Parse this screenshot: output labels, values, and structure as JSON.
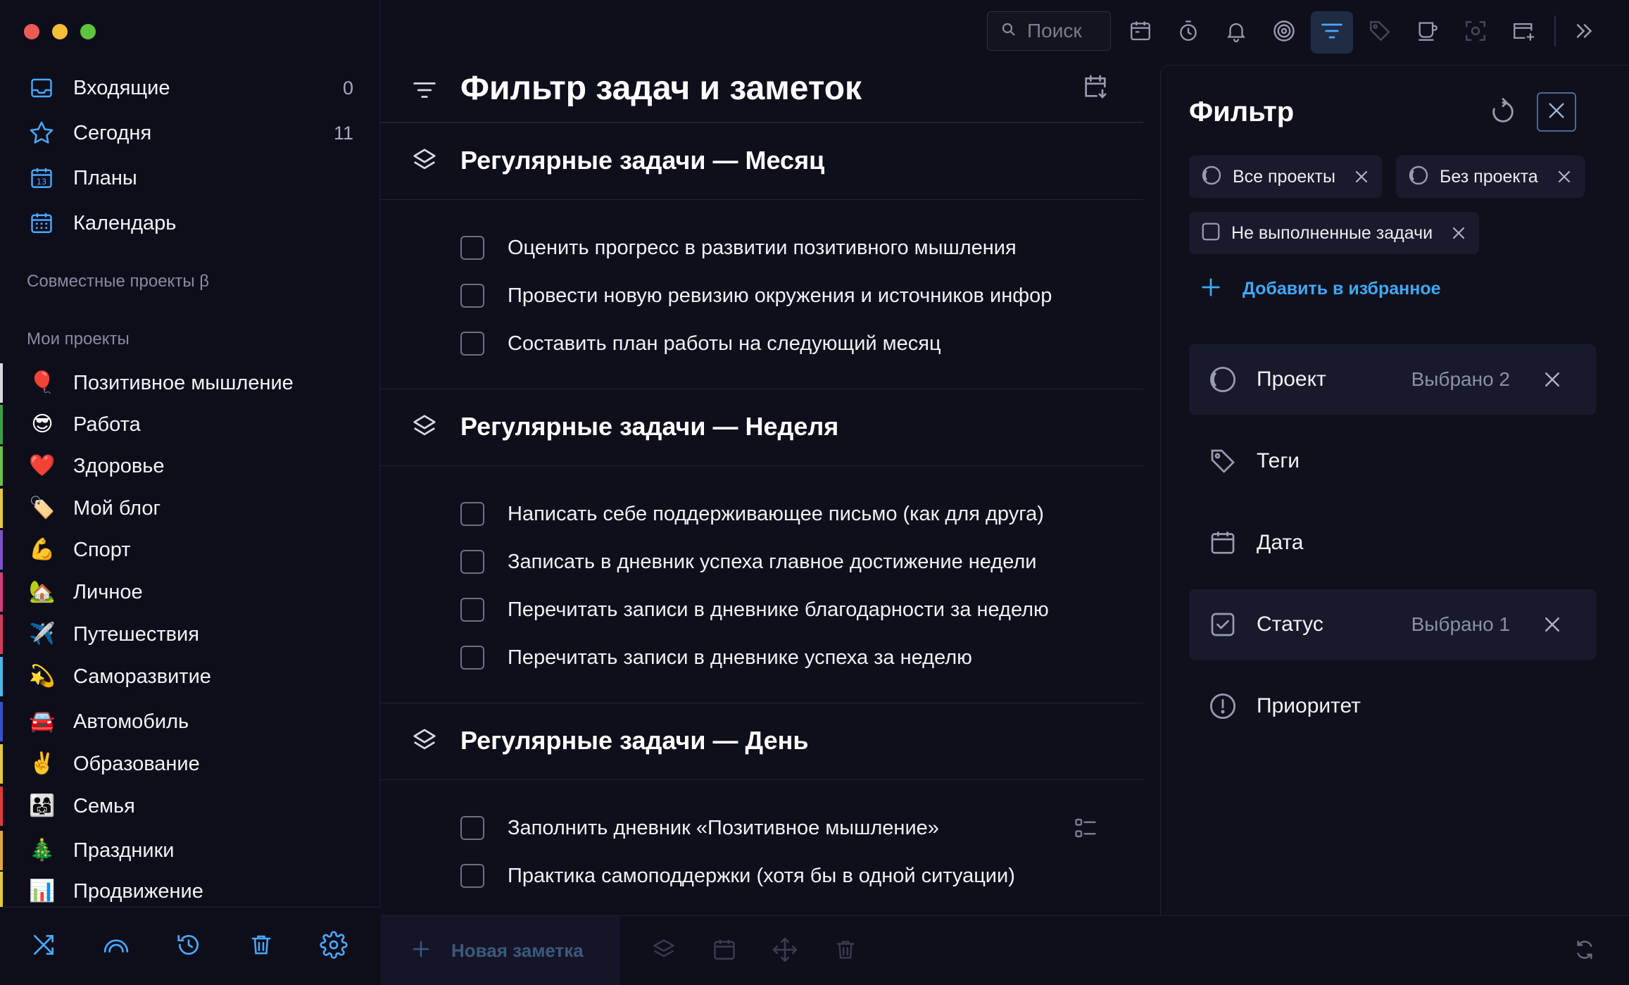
{
  "colors": {
    "background": "#0f0f1c",
    "accent": "#3fa9f5",
    "muted": "#8a8aa3"
  },
  "sidebar": {
    "nav": [
      {
        "label": "Входящие",
        "count": "0",
        "icon": "inbox-icon"
      },
      {
        "label": "Сегодня",
        "count": "11",
        "icon": "star-icon"
      },
      {
        "label": "Планы",
        "count": "",
        "icon": "calendar-13-icon"
      },
      {
        "label": "Календарь",
        "count": "",
        "icon": "calendar-grid-icon"
      }
    ],
    "shared_label": "Совместные проекты β",
    "my_projects_label": "Мои проекты",
    "projects": [
      {
        "label": "Позитивное мышление",
        "emoji": "🎈",
        "color": "#d8d8e0"
      },
      {
        "label": "Работа",
        "emoji": "😎",
        "color": "#3aa048"
      },
      {
        "label": "Здоровье",
        "emoji": "❤️",
        "color": "#6cc04a"
      },
      {
        "label": "Мой блог",
        "emoji": "🏷️",
        "color": "#e6c93a"
      },
      {
        "label": "Спорт",
        "emoji": "💪",
        "color": "#7b4fd0"
      },
      {
        "label": "Личное",
        "emoji": "🏡",
        "color": "#d63a7a"
      },
      {
        "label": "Путешествия",
        "emoji": "✈️",
        "color": "#d63a5a"
      },
      {
        "label": "Саморазвитие",
        "emoji": "💫",
        "color": "#49b8e8"
      },
      {
        "label": "Автомобиль",
        "emoji": "🚘",
        "color": "#3a4fd0"
      },
      {
        "label": "Образование",
        "emoji": "✌️",
        "color": "#e6c93a"
      },
      {
        "label": "Семья",
        "emoji": "👨‍👩‍👧",
        "color": "#e03a3a"
      },
      {
        "label": "Праздники",
        "emoji": "🎄",
        "color": "#e6a83a"
      },
      {
        "label": "Продвижение",
        "emoji": "📊",
        "color": "#e6c93a"
      }
    ]
  },
  "toolbar": {
    "search_placeholder": "Поиск"
  },
  "main": {
    "title": "Фильтр задач и заметок",
    "groups": [
      {
        "title": "Регулярные задачи — Месяц",
        "tasks": [
          "Оценить прогресс в развитии позитивного мышления",
          "Провести новую ревизию окружения и источников инфор",
          "Составить план работы на следующий месяц"
        ]
      },
      {
        "title": "Регулярные задачи — Неделя",
        "tasks": [
          "Написать себе поддерживающее письмо (как для друга)",
          "Записать в дневник успеха главное достижение недели",
          "Перечитать записи в дневнике благодарности за неделю",
          "Перечитать записи в дневнике успеха за неделю"
        ]
      },
      {
        "title": "Регулярные задачи — День",
        "tasks": [
          "Заполнить дневник «Позитивное мышление»",
          "Практика самоподдержки (хотя бы в одной ситуации)"
        ]
      }
    ],
    "new_note_label": "Новая заметка"
  },
  "filter": {
    "title": "Фильтр",
    "chips": [
      "Все проекты",
      "Без проекта",
      "Не выполненные задачи"
    ],
    "add_favorite": "Добавить в избранное",
    "rows": [
      {
        "label": "Проект",
        "value": "Выбрано 2"
      },
      {
        "label": "Теги",
        "value": ""
      },
      {
        "label": "Дата",
        "value": ""
      },
      {
        "label": "Статус",
        "value": "Выбрано 1"
      },
      {
        "label": "Приоритет",
        "value": ""
      }
    ]
  }
}
